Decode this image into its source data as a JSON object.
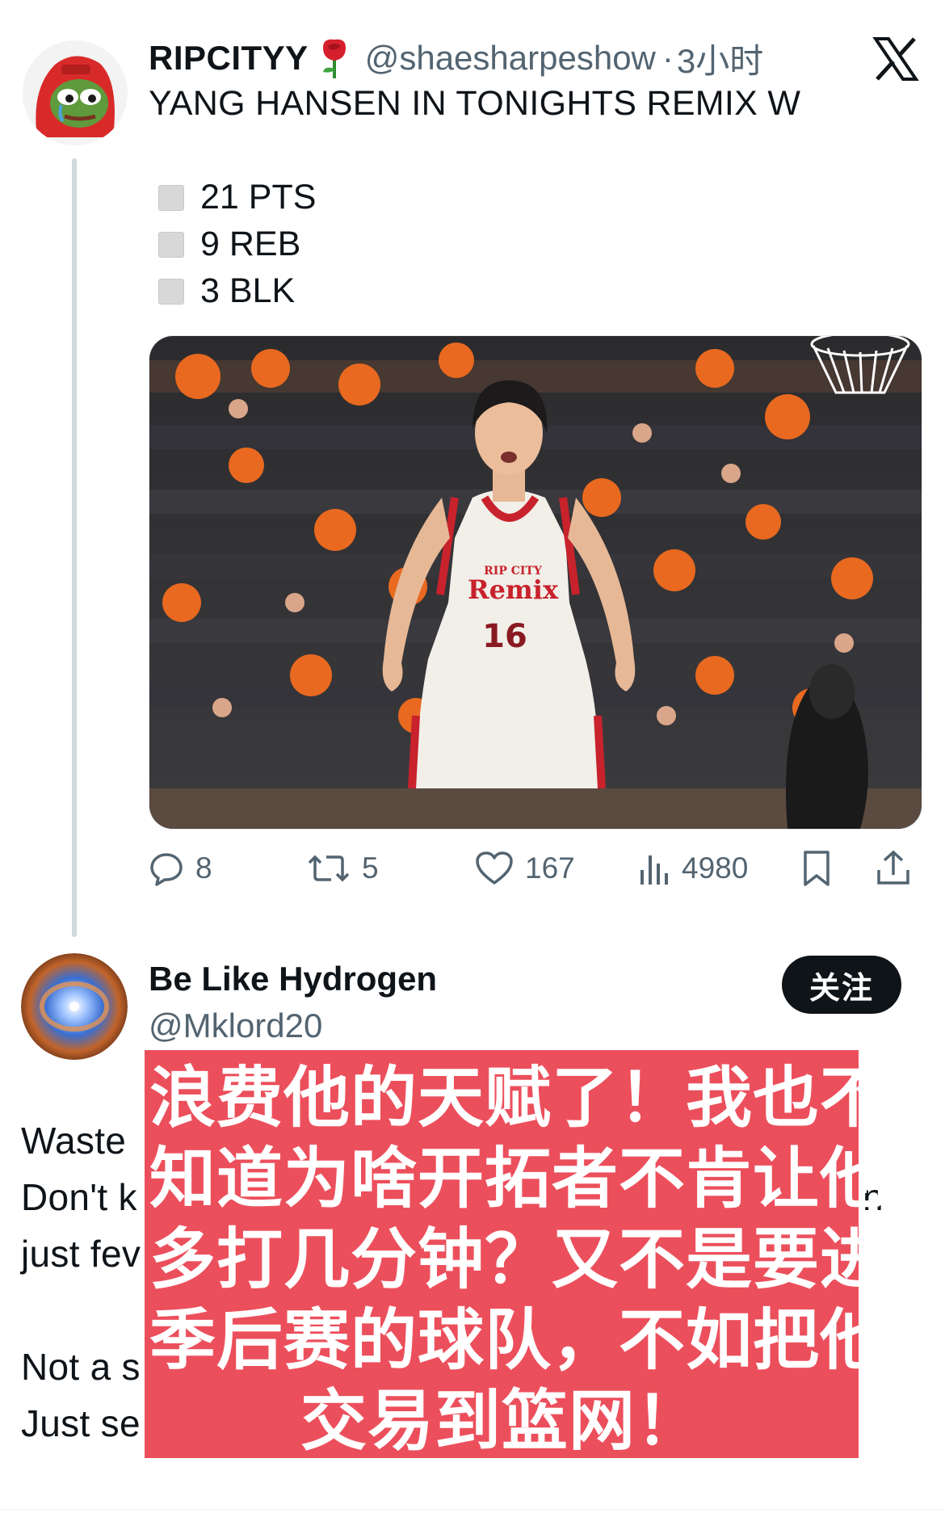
{
  "tweet1": {
    "name": "RIPCITYY",
    "name_emoji": "rose",
    "handle": "@shaesharpeshow",
    "time_sep": "·",
    "time": "3小时",
    "text": "YANG HANSEN IN TONIGHTS REMIX W",
    "stats": [
      "21 PTS",
      "9 REB",
      "3 BLK"
    ],
    "actions": {
      "replies": "8",
      "reposts": "5",
      "likes": "167",
      "views": "4980"
    },
    "jersey_text": "Remix",
    "jersey_small": "RIP CITY",
    "jersey_number": "16"
  },
  "tweet2": {
    "name": "Be Like Hydrogen",
    "handle": "@Mklord20",
    "follow_label": "关注",
    "lines": [
      "Waste",
      "Don't k",
      "n",
      "just fev",
      "Not a s",
      "Just se"
    ]
  },
  "overlay": {
    "lines": [
      "浪费他的天赋了！我也不",
      "知道为啥开拓者不肯让他",
      "多打几分钟？又不是要进",
      "季后赛的球队，不如把他",
      "交易到篮网！"
    ]
  },
  "colors": {
    "overlay_bg": "#ec4f5c",
    "text_primary": "#0f1419",
    "text_secondary": "#536471",
    "thread_line": "#cfd9de"
  },
  "icons": [
    "x-logo-icon",
    "rose-emoji-icon",
    "reply-icon",
    "repost-icon",
    "like-icon",
    "views-icon",
    "bookmark-icon",
    "share-icon"
  ]
}
